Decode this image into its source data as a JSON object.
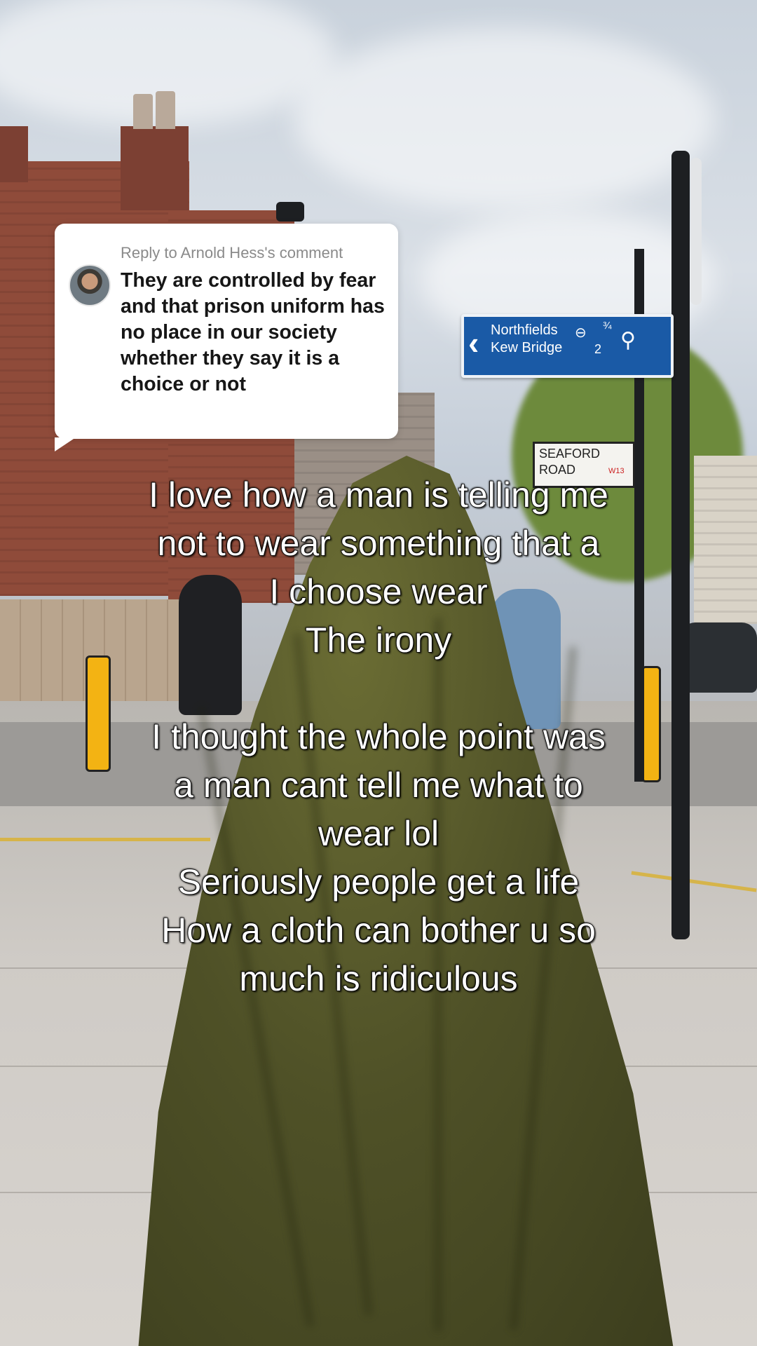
{
  "comment": {
    "reply_to": "Reply to Arnold Hess's comment",
    "text": "They are controlled by fear and that prison uniform has no place in our society whether they say it is a choice or not"
  },
  "overlay_text": "I love how a man is telling me\nnot to wear something that a\nI choose wear\nThe irony\n\nI thought the whole point was\na man cant tell me what to\nwear lol\nSeriously people get a life\nHow a cloth can bother u so\nmuch is ridiculous",
  "signs": {
    "direction_line1": "Northfields",
    "direction_line2": "Kew Bridge",
    "distance1": "¾",
    "distance2": "2",
    "street_line1": "SEAFORD",
    "street_line2": "ROAD",
    "postcode": "W13"
  },
  "colors": {
    "sign_blue": "#1a5aa6",
    "cloak_green": "#4f5127",
    "comment_bg": "#ffffff"
  }
}
